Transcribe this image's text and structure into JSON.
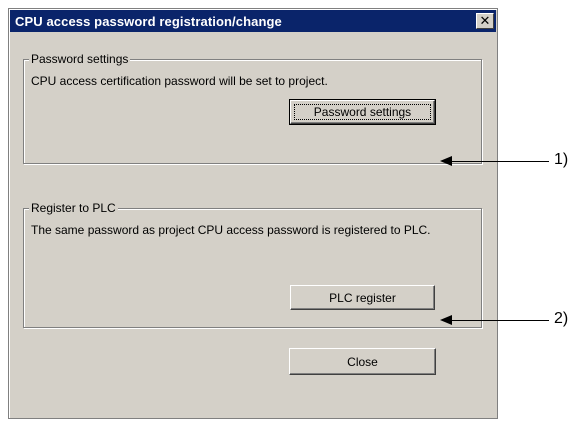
{
  "window": {
    "title": "CPU access password registration/change",
    "close_glyph": "✕"
  },
  "password_settings_group": {
    "legend": "Password settings",
    "description": "CPU access certification password will be set to project.",
    "button_label": "Password settings"
  },
  "register_group": {
    "legend": "Register to PLC",
    "description": "The same password as project CPU access password is registered to PLC.",
    "button_label": "PLC register"
  },
  "footer": {
    "close_label": "Close"
  },
  "callouts": {
    "label_1": "1)",
    "label_2": "2)"
  }
}
